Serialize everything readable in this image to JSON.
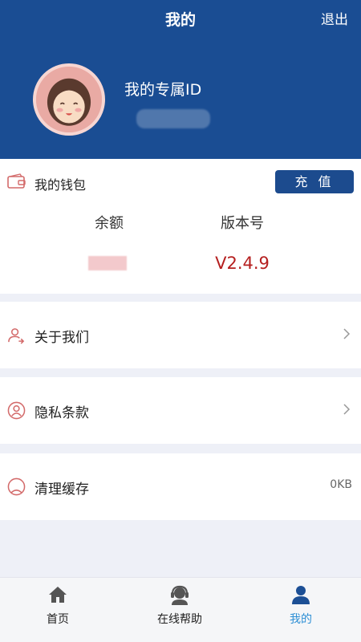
{
  "header": {
    "title": "我的",
    "logout_label": "退出",
    "user_id_label": "我的专属ID"
  },
  "wallet": {
    "title": "我的钱包",
    "recharge_label": "充 值",
    "balance_label": "余额",
    "version_label": "版本号",
    "version_value": "V2.4.9"
  },
  "menu": {
    "about_label": "关于我们",
    "privacy_label": "隐私条款",
    "clear_cache_label": "清理缓存",
    "cache_size": "0KB"
  },
  "tabbar": {
    "home_label": "首页",
    "help_label": "在线帮助",
    "mine_label": "我的",
    "active_color": "#2d8fd5"
  },
  "colors": {
    "header_bg": "#1a4d93",
    "accent_red": "#b51f1f"
  }
}
